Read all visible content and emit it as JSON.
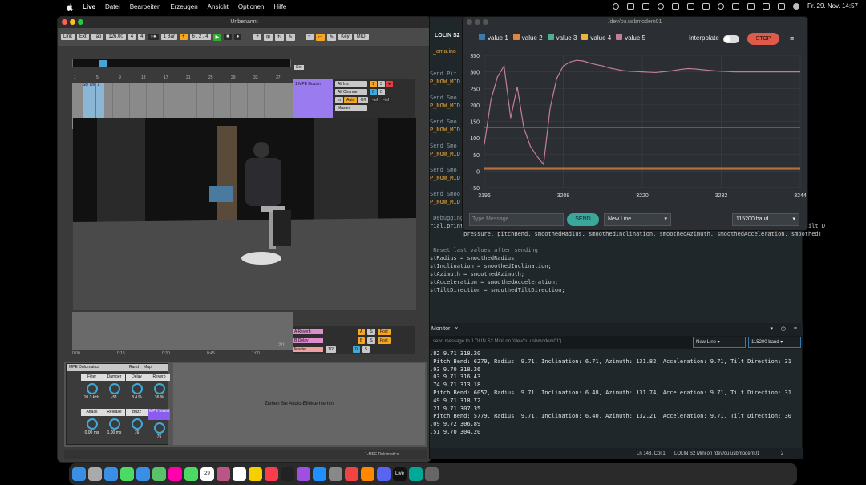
{
  "menubar": {
    "app_name": "Live",
    "items": [
      "Datei",
      "Bearbeiten",
      "Erzeugen",
      "Ansicht",
      "Optionen",
      "Hilfe"
    ],
    "clock": "Fr. 29. Nov.  14:57"
  },
  "live": {
    "title": "Unbenannt",
    "controls": {
      "link": "Link",
      "ext": "Ext",
      "tap": "Tap",
      "tempo": "126.00",
      "sig_num": "4",
      "sig_den": "4",
      "quant": "1 Bar",
      "pos": "6 . 2 . 4",
      "key": "Key",
      "midi": "MIDI"
    },
    "ruler": [
      "1",
      "5",
      "9",
      "13",
      "17",
      "21",
      "25",
      "29",
      "33",
      "37"
    ],
    "set_label": "Set",
    "clip_label": "Sty and 1",
    "track": {
      "name": "1 MPE Dulcim",
      "input": "All Ins",
      "channel": "All Channe",
      "monitor_in": "In",
      "monitor_auto": "Auto",
      "monitor_off": "Off",
      "out": "Master",
      "number": "1",
      "s": "S",
      "c": "C",
      "inf1": "-inf",
      "inf2": "-inf",
      "zero": "0"
    },
    "returns": [
      {
        "label": "A Reverb",
        "letter": "A",
        "s": "S",
        "post": "Post"
      },
      {
        "label": "B Delay",
        "letter": "B",
        "s": "S",
        "post": "Post"
      },
      {
        "label": "Master",
        "letter": "",
        "s": "S",
        "post": "1/2",
        "zero": "0"
      }
    ],
    "timebar": [
      "0:00",
      "0:15",
      "0:30",
      "0:45",
      "1:00"
    ],
    "scroll_marker": "2/1",
    "device": {
      "name": "MPE Dulcimatica",
      "rand": "Rand",
      "map": "Map",
      "knobs": [
        {
          "label": "Filter",
          "value": "10.3 kHz"
        },
        {
          "label": "Damper",
          "value": "-51"
        },
        {
          "label": "Delay",
          "value": "8.4 %"
        },
        {
          "label": "Reverb",
          "value": "36 %"
        },
        {
          "label": "Attack",
          "value": "0.00 ms"
        },
        {
          "label": "Release",
          "value": "1.00 ms"
        },
        {
          "label": "Buzz",
          "value": "76"
        },
        {
          "label": "MPE Invert",
          "value": "76"
        }
      ],
      "dropzone": "Ziehen Sie Audio-Effekte hierhin"
    },
    "status_track": "1-MPE Dulcimatica"
  },
  "editor": {
    "tab_board": "LOLIN S2",
    "file": "_ema.ino",
    "code_lines": [
      {
        "text": "Send Pit",
        "cls": "gray"
      },
      {
        "text": "P_NOW_MID",
        "cls": "orange"
      },
      {
        "text": "",
        "cls": ""
      },
      {
        "text": "Send Smo",
        "cls": "gray"
      },
      {
        "text": "P_NOW_MID",
        "cls": "orange"
      },
      {
        "text": "",
        "cls": ""
      },
      {
        "text": "Send Smo",
        "cls": "gray"
      },
      {
        "text": "P_NOW_MID",
        "cls": "orange"
      },
      {
        "text": "",
        "cls": ""
      },
      {
        "text": "Send Smo",
        "cls": "gray"
      },
      {
        "text": "P_NOW_MID",
        "cls": "orange"
      },
      {
        "text": "",
        "cls": ""
      },
      {
        "text": "Send Smo",
        "cls": "gray"
      },
      {
        "text": "P_NOW_MID",
        "cls": "orange"
      },
      {
        "text": "",
        "cls": ""
      },
      {
        "text": "Send Smoo",
        "cls": "gray"
      },
      {
        "text": "P_NOW_MID",
        "cls": "orange"
      },
      {
        "text": "",
        "cls": ""
      },
      {
        "text": " Debugging info",
        "cls": "gray"
      },
      {
        "text": "rial.printf(\"Pressure: %d, Pitch Bend: %d, Radius: %.2f, Inclination: %.2f, Azimuth: %.2f, Acceleration: %.2f, Tilt D",
        "cls": ""
      },
      {
        "text": "          pressure, pitchBend, smoothedRadius, smoothedInclination, smoothedAzimuth, smoothedAcceleration, smoothedT",
        "cls": ""
      },
      {
        "text": "",
        "cls": ""
      },
      {
        "text": " Reset last values after sending",
        "cls": "gray"
      },
      {
        "text": "stRadius = smoothedRadius;",
        "cls": ""
      },
      {
        "text": "stInclination = smoothedInclination;",
        "cls": ""
      },
      {
        "text": "stAzimuth = smoothedAzimuth;",
        "cls": ""
      },
      {
        "text": "stAcceleration = smoothedAcceleration;",
        "cls": ""
      },
      {
        "text": "stTiltDirection = smoothedTiltDirection;",
        "cls": ""
      }
    ],
    "monitor_tab": "Monitor",
    "send_placeholder": "send message to 'LOLIN S2 Mini' on '/dev/cu.usbmodem01')",
    "line_ending": "New Line",
    "baud": "115200 baud",
    "serial_lines": [
      ".82 9.71 318.20",
      " Pitch Bend: 6279, Radius: 9.71, Inclination: 6.71, Azimuth: 131.82, Acceleration: 9.71, Tilt Direction: 31",
      ".93 9.70 318.26",
      ".03 9.71 316.43",
      ".74 9.71 313.18",
      " Pitch Bend: 6052, Radius: 9.71, Inclination: 6.48, Azimuth: 131.74, Acceleration: 9.71, Tilt Direction: 31",
      ".49 9.71 318.72",
      ".21 9.71 307.35",
      " Pitch Bend: 5779, Radius: 9.71, Inclination: 6.40, Azimuth: 132.21, Acceleration: 9.71, Tilt Direction: 30",
      ".09 9.72 306.89",
      ".51 9.70 304.20"
    ],
    "status_pos": "Ln 148, Col 1",
    "status_board": "LOLIN S2 Mini on /dev/cu.usbmodem01",
    "status_count": "2"
  },
  "plotter": {
    "title": "/dev/cu.usbmodem01",
    "interpolate": "Interpolate",
    "stop": "STOP",
    "message_placeholder": "Type Message",
    "send": "SEND",
    "line_ending": "New Line",
    "baud": "115200 baud",
    "chart_data": {
      "type": "line",
      "x": [
        3196,
        3197,
        3198,
        3199,
        3200,
        3201,
        3202,
        3203,
        3204,
        3205,
        3206,
        3207,
        3208,
        3209,
        3210,
        3211,
        3212,
        3213,
        3214,
        3215,
        3216,
        3217,
        3218,
        3219,
        3220,
        3221,
        3222,
        3223,
        3224,
        3225,
        3226,
        3227,
        3228,
        3229,
        3230,
        3231,
        3232,
        3233,
        3234,
        3235,
        3236,
        3237,
        3238,
        3239,
        3240,
        3241,
        3242,
        3243,
        3244
      ],
      "xlim": [
        3196,
        3244
      ],
      "ylim": [
        -50,
        350
      ],
      "xticks": [
        3196,
        3208,
        3220,
        3232,
        3244
      ],
      "yticks": [
        -50,
        0,
        50,
        100,
        150,
        200,
        250,
        300,
        350
      ],
      "series": [
        {
          "name": "value 1",
          "color": "#3a7ab0",
          "values": [
            10,
            10,
            10,
            10,
            10,
            10,
            10,
            10,
            10,
            10,
            10,
            10,
            10,
            10,
            10,
            10,
            10,
            10,
            10,
            10,
            10,
            10,
            10,
            10,
            10,
            10,
            10,
            10,
            10,
            10,
            10,
            10,
            10,
            10,
            10,
            10,
            10,
            10,
            10,
            10,
            10,
            10,
            10,
            10,
            10,
            10,
            10,
            10,
            10
          ]
        },
        {
          "name": "value 2",
          "color": "#e8833a",
          "values": [
            6,
            6,
            6,
            6,
            6,
            6,
            6,
            6,
            6,
            6,
            6,
            6,
            6,
            6,
            6,
            6,
            6,
            6,
            6,
            6,
            6,
            6,
            6,
            6,
            6,
            6,
            6,
            6,
            6,
            6,
            6,
            6,
            6,
            6,
            6,
            6,
            6,
            6,
            6,
            6,
            6,
            6,
            6,
            6,
            6,
            6,
            6,
            6,
            6
          ]
        },
        {
          "name": "value 3",
          "color": "#4caf93",
          "values": [
            132,
            132,
            132,
            132,
            132,
            132,
            132,
            132,
            132,
            132,
            132,
            132,
            132,
            132,
            132,
            132,
            132,
            132,
            132,
            132,
            132,
            132,
            132,
            132,
            132,
            132,
            132,
            132,
            132,
            132,
            132,
            132,
            132,
            132,
            132,
            132,
            132,
            132,
            132,
            132,
            132,
            132,
            132,
            132,
            132,
            132,
            132,
            132,
            132
          ]
        },
        {
          "name": "value 4",
          "color": "#e8b43a",
          "values": [
            9.7,
            9.7,
            9.7,
            9.7,
            9.7,
            9.7,
            9.7,
            9.7,
            9.7,
            9.7,
            9.7,
            9.7,
            9.7,
            9.7,
            9.7,
            9.7,
            9.7,
            9.7,
            9.7,
            9.7,
            9.7,
            9.7,
            9.7,
            9.7,
            9.7,
            9.7,
            9.7,
            9.7,
            9.7,
            9.7,
            9.7,
            9.7,
            9.7,
            9.7,
            9.7,
            9.7,
            9.7,
            9.7,
            9.7,
            9.7,
            9.7,
            9.7,
            9.7,
            9.7,
            9.7,
            9.7,
            9.7,
            9.7,
            9.7
          ]
        },
        {
          "name": "value 5",
          "color": "#c77aa0",
          "values": [
            80,
            215,
            285,
            318,
            160,
            255,
            130,
            75,
            45,
            20,
            190,
            280,
            318,
            330,
            335,
            333,
            327,
            322,
            318,
            312,
            308,
            304,
            302,
            301,
            300,
            299,
            298,
            300,
            302,
            305,
            308,
            310,
            309,
            307,
            305,
            303,
            302,
            301,
            300,
            300,
            300,
            300,
            300,
            300,
            300,
            300,
            300,
            300,
            300
          ]
        }
      ]
    }
  },
  "dock": {
    "icons": [
      "finder-icon",
      "launchpad-icon",
      "safari-icon",
      "messages-icon",
      "mail-icon",
      "maps-icon",
      "photos-icon",
      "facetime-icon",
      "calendar-icon",
      "contacts-icon",
      "reminders-icon",
      "notes-icon",
      "music-icon",
      "tv-icon",
      "podcasts-icon",
      "appstore-icon",
      "settings-icon",
      "chrome-icon",
      "firefox-icon",
      "discord-icon",
      "live-icon",
      "arduino-icon",
      "other-icon"
    ],
    "calendar_day": "29",
    "live_label": "Live"
  }
}
